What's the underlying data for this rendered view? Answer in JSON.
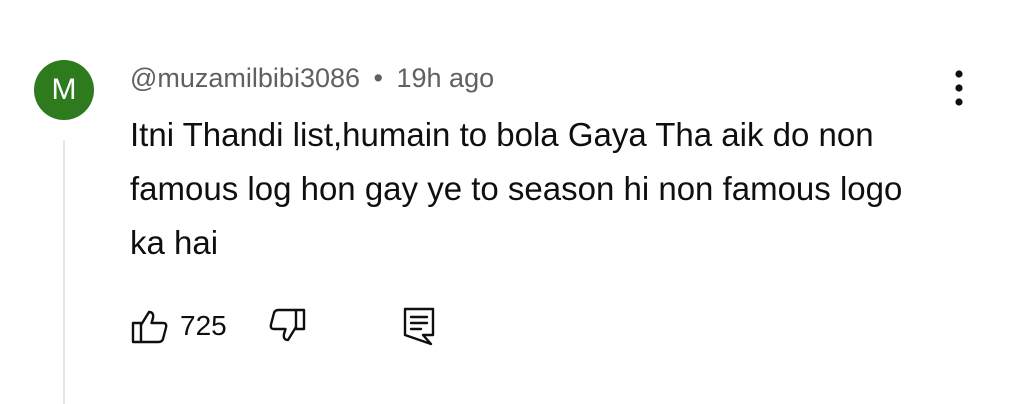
{
  "comment": {
    "avatar_initial": "M",
    "avatar_color": "#2e7b1e",
    "author": "@muzamilbibi3086",
    "separator": "•",
    "timestamp": "19h ago",
    "text": "Itni Thandi list,humain to bola Gaya Tha aik do non famous log hon gay ye to season hi non famous logo ka hai",
    "like_count": "725"
  },
  "icons": {
    "like": "thumbs-up-icon",
    "dislike": "thumbs-down-icon",
    "reply": "reply-comment-icon",
    "menu": "more-vert-icon"
  }
}
